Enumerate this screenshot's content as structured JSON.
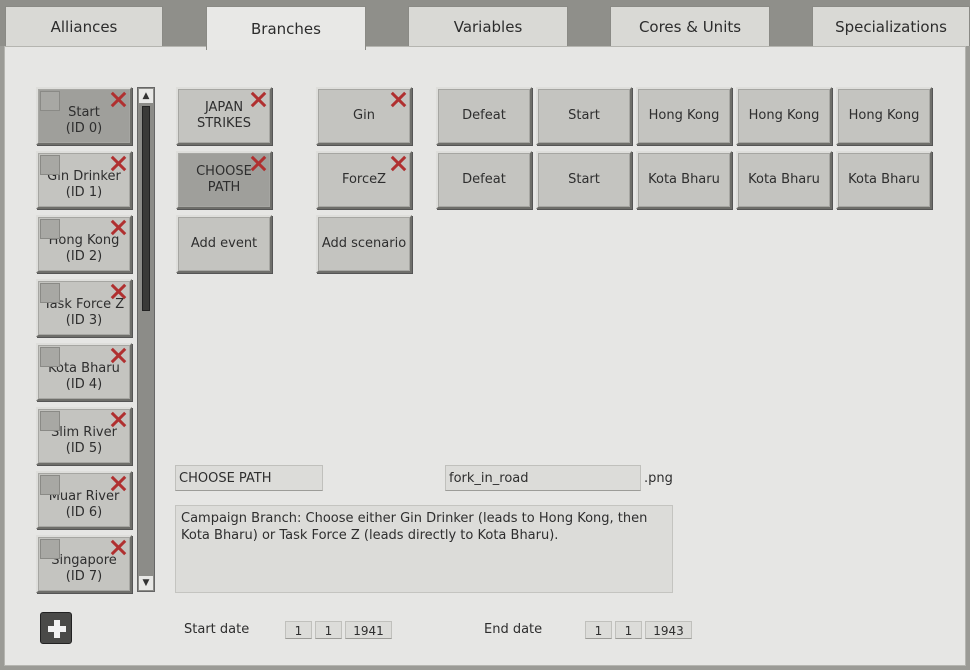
{
  "tabs": [
    {
      "label": "Alliances"
    },
    {
      "label": "Branches"
    },
    {
      "label": "Variables"
    },
    {
      "label": "Cores & Units"
    },
    {
      "label": "Specializations"
    }
  ],
  "active_tab": "Branches",
  "scenarios": [
    {
      "name": "Start",
      "id": "(ID 0)"
    },
    {
      "name": "Gin Drinker",
      "id": "(ID 1)"
    },
    {
      "name": "Hong Kong",
      "id": "(ID 2)"
    },
    {
      "name": "Task Force Z",
      "id": "(ID 3)"
    },
    {
      "name": "Kota Bharu",
      "id": "(ID 4)"
    },
    {
      "name": "Slim River",
      "id": "(ID 5)"
    },
    {
      "name": "Muar River",
      "id": "(ID 6)"
    },
    {
      "name": "Singapore",
      "id": "(ID 7)"
    }
  ],
  "events": [
    {
      "label": "JAPAN STRIKES"
    },
    {
      "label": "CHOOSE PATH"
    }
  ],
  "add_event_label": "Add event",
  "branch_scenarios": [
    {
      "label": "Gin"
    },
    {
      "label": "ForceZ"
    }
  ],
  "add_scenario_label": "Add scenario",
  "outcome_rows": [
    [
      "Defeat",
      "Start",
      "Hong Kong",
      "Hong Kong",
      "Hong Kong"
    ],
    [
      "Defeat",
      "Start",
      "Kota Bharu",
      "Kota Bharu",
      "Kota Bharu"
    ]
  ],
  "event_name_value": "CHOOSE PATH",
  "image_name_value": "fork_in_road",
  "image_ext": ".png",
  "description": "Campaign Branch: Choose either Gin Drinker (leads to Hong Kong, then Kota Bharu) or Task Force Z (leads directly to Kota Bharu).",
  "start_date": {
    "label": "Start date",
    "day": "1",
    "month": "1",
    "year": "1941"
  },
  "end_date": {
    "label": "End date",
    "day": "1",
    "month": "1",
    "year": "1943"
  },
  "icons": {
    "delete": "close-x-icon",
    "add": "plus-icon",
    "scroll_up": "chevron-up-icon",
    "scroll_down": "chevron-down-icon"
  },
  "colors": {
    "delete_x": "#b03030",
    "panel": "#e6e6e4",
    "button": "#c4c4c0"
  }
}
